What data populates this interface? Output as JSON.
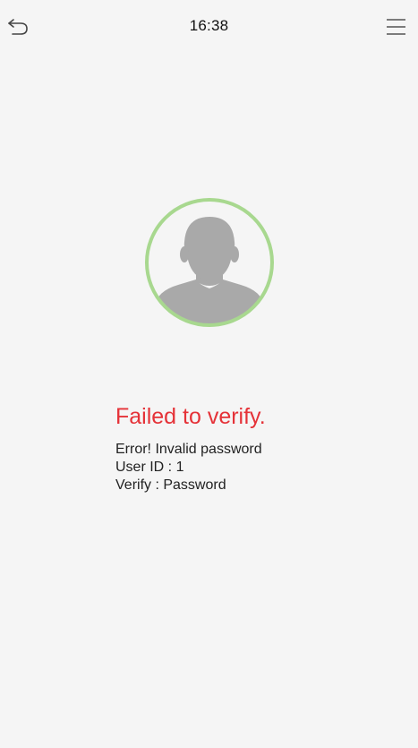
{
  "status_bar": {
    "time": "16:38",
    "back_icon": "back-arrow-icon",
    "menu_icon": "hamburger-menu-icon"
  },
  "avatar": {
    "icon": "user-silhouette-icon",
    "ring_color": "#a8d88f",
    "silhouette_color": "#a9a9a9"
  },
  "result": {
    "title": "Failed to verify.",
    "title_color": "#e53238",
    "error": "Error! Invalid password",
    "user_id": "User ID : 1",
    "verify": "Verify : Password"
  }
}
